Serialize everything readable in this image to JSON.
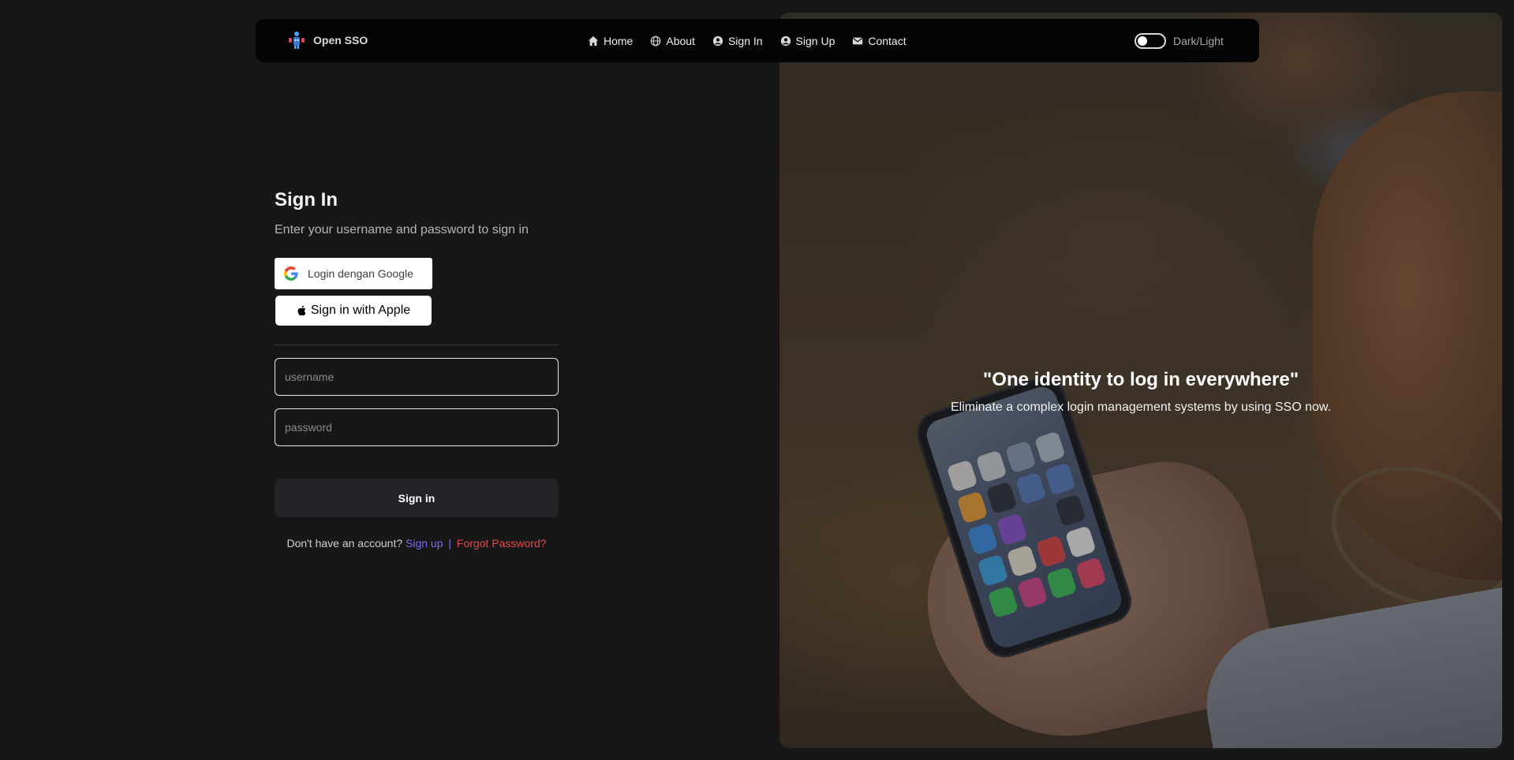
{
  "nav": {
    "brand": "Open SSO",
    "links": [
      {
        "label": "Home",
        "icon": "home-icon"
      },
      {
        "label": "About",
        "icon": "globe-icon"
      },
      {
        "label": "Sign In",
        "icon": "user-circle-icon"
      },
      {
        "label": "Sign Up",
        "icon": "user-circle-icon"
      },
      {
        "label": "Contact",
        "icon": "envelope-icon"
      }
    ],
    "theme_label": "Dark/Light"
  },
  "signin": {
    "title": "Sign In",
    "subtitle": "Enter your username and password to sign in",
    "google_label": "Login dengan Google",
    "apple_label": "Sign in with Apple",
    "username_placeholder": "username",
    "password_placeholder": "password",
    "submit_label": "Sign in",
    "no_account_text": "Don't have an account?",
    "signup_link": "Sign up",
    "separator": "|",
    "forgot_link": "Forgot Password?"
  },
  "hero": {
    "title": "\"One identity to log in everywhere\"",
    "subtitle": "Eliminate a complex login management systems by using SSO now."
  },
  "colors": {
    "background": "#171717",
    "navbar": "#050505",
    "signup_link": "#7a6cf0",
    "forgot_link": "#e04848"
  }
}
